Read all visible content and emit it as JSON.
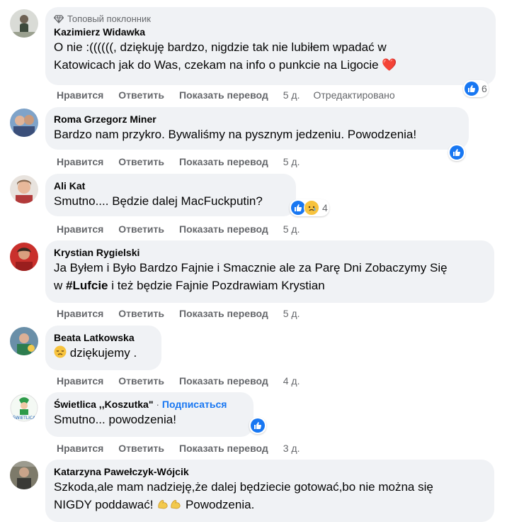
{
  "common": {
    "like": "Нравится",
    "reply": "Ответить",
    "translate": "Показать перевод"
  },
  "comments": [
    {
      "badge": "Топовый поклонник",
      "author": "Kazimierz Widawka",
      "text_line1": "O nie :((((((, dziękuję bardzo, nigdzie tak nie lubiłem wpadać w",
      "text_line2": "Katowicach jak do Was, czekam na info o punkcie na Ligocie",
      "heart": "❤️",
      "time": "5 д.",
      "edited": "Отредактировано",
      "reactions_count": "6"
    },
    {
      "author": "Roma Grzegorz Miner",
      "text": "Bardzo nam przykro. Bywaliśmy na pysznym jedzeniu. Powodzenia!",
      "time": "5 д."
    },
    {
      "author": "Ali Kat",
      "text": "Smutno.... Będzie dalej MacFuckputin?",
      "time": "5 д.",
      "reactions_count": "4"
    },
    {
      "author": "Krystian Rygielski",
      "text_line1": "Ja Byłem i Było Bardzo Fajnie i Smacznie ale za Parę Dni Zobaczymy Się",
      "text_line2_pre": "w ",
      "hashtag": "#Lufcie",
      "text_line2_post": " i też będzie Fajnie Pozdrawiam Krystian",
      "time": "5 д."
    },
    {
      "author": "Beata Latkowska",
      "text": "dziękujemy .",
      "time": "4 д."
    },
    {
      "author": "Świetlica ,,Koszutka\"",
      "follow": "Подписаться",
      "separator": " · ",
      "text": "Smutno... powodzenia!",
      "time": "3 д."
    },
    {
      "author": "Katarzyna Pawełczyk-Wójcik",
      "text_line1": "Szkoda,ale mam nadzieję,że dalej będziecie gotować,bo nie można się",
      "text_line2_pre": "NIGDY poddawać!",
      "text_line2_post": " Powodzenia."
    }
  ],
  "icons": {
    "like": "like-icon",
    "sad": "sad-emoji-icon",
    "badge": "diamond-icon",
    "flex": "flexed-biceps-emoji"
  }
}
